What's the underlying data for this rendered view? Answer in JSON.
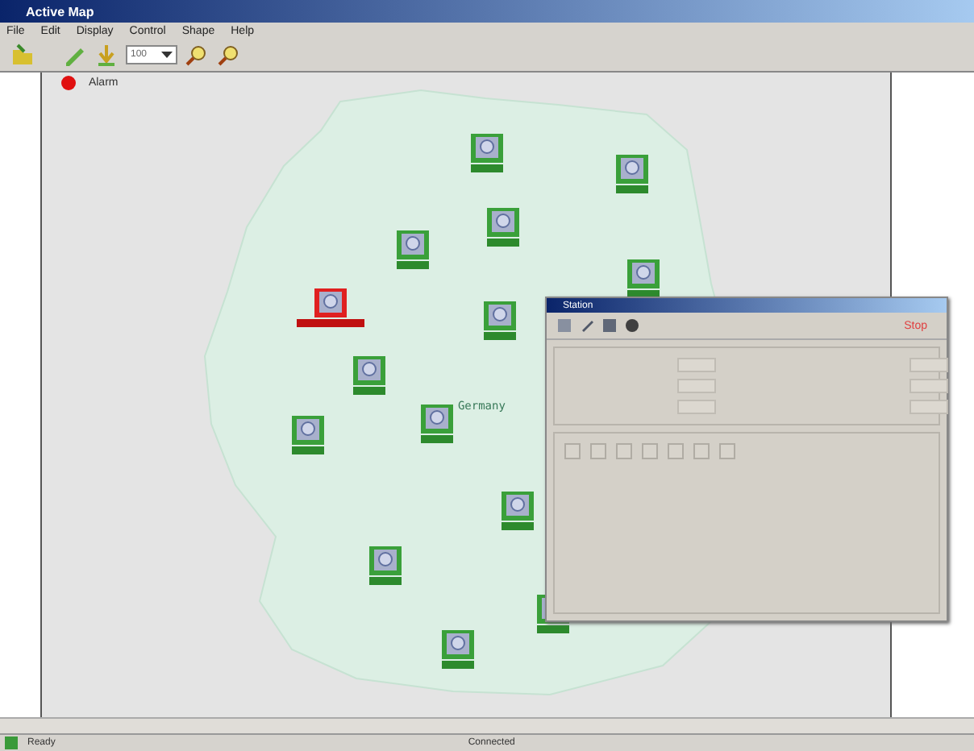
{
  "window": {
    "title": "Active Map"
  },
  "menu": [
    "File",
    "Edit",
    "Display",
    "Control",
    "Shape",
    "Help"
  ],
  "toolbar": {
    "zoom": "100"
  },
  "legend": [
    {
      "label": "Alarm",
      "color": "#e01010"
    }
  ],
  "map": {
    "label": "Germany"
  },
  "nodes": [
    {
      "alarm": false
    },
    {
      "alarm": false
    },
    {
      "alarm": false
    },
    {
      "alarm": false
    },
    {
      "alarm": false
    },
    {
      "alarm": true
    },
    {
      "alarm": false
    },
    {
      "alarm": false
    },
    {
      "alarm": false
    },
    {
      "alarm": false
    },
    {
      "alarm": false
    },
    {
      "alarm": false
    },
    {
      "alarm": false
    },
    {
      "alarm": false
    }
  ],
  "dialog": {
    "title": "Station",
    "status": "Stop"
  },
  "status_bar": {
    "left": "Ready",
    "center": "Connected"
  }
}
